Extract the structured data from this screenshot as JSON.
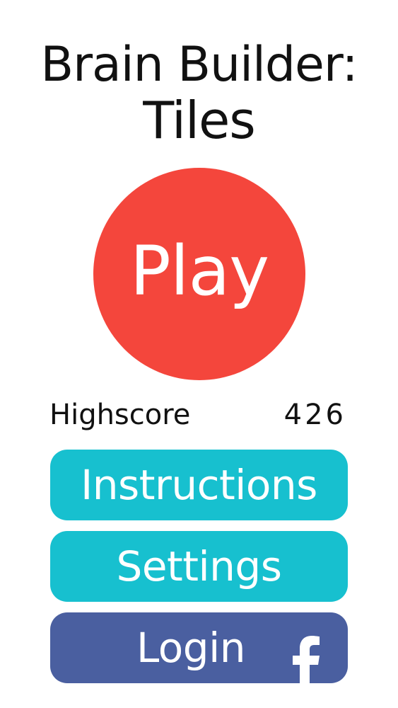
{
  "title": {
    "line1": "Brain Builder:",
    "line2": "Tiles"
  },
  "play": {
    "label": "Play",
    "color": "#f4463c"
  },
  "highscore": {
    "label": "Highscore",
    "value": "426"
  },
  "menu": {
    "instructions_label": "Instructions",
    "settings_label": "Settings",
    "login_label": "Login",
    "primary_color": "#17c0cf",
    "facebook_color": "#4a5fa0",
    "login_icon": "facebook-icon"
  }
}
